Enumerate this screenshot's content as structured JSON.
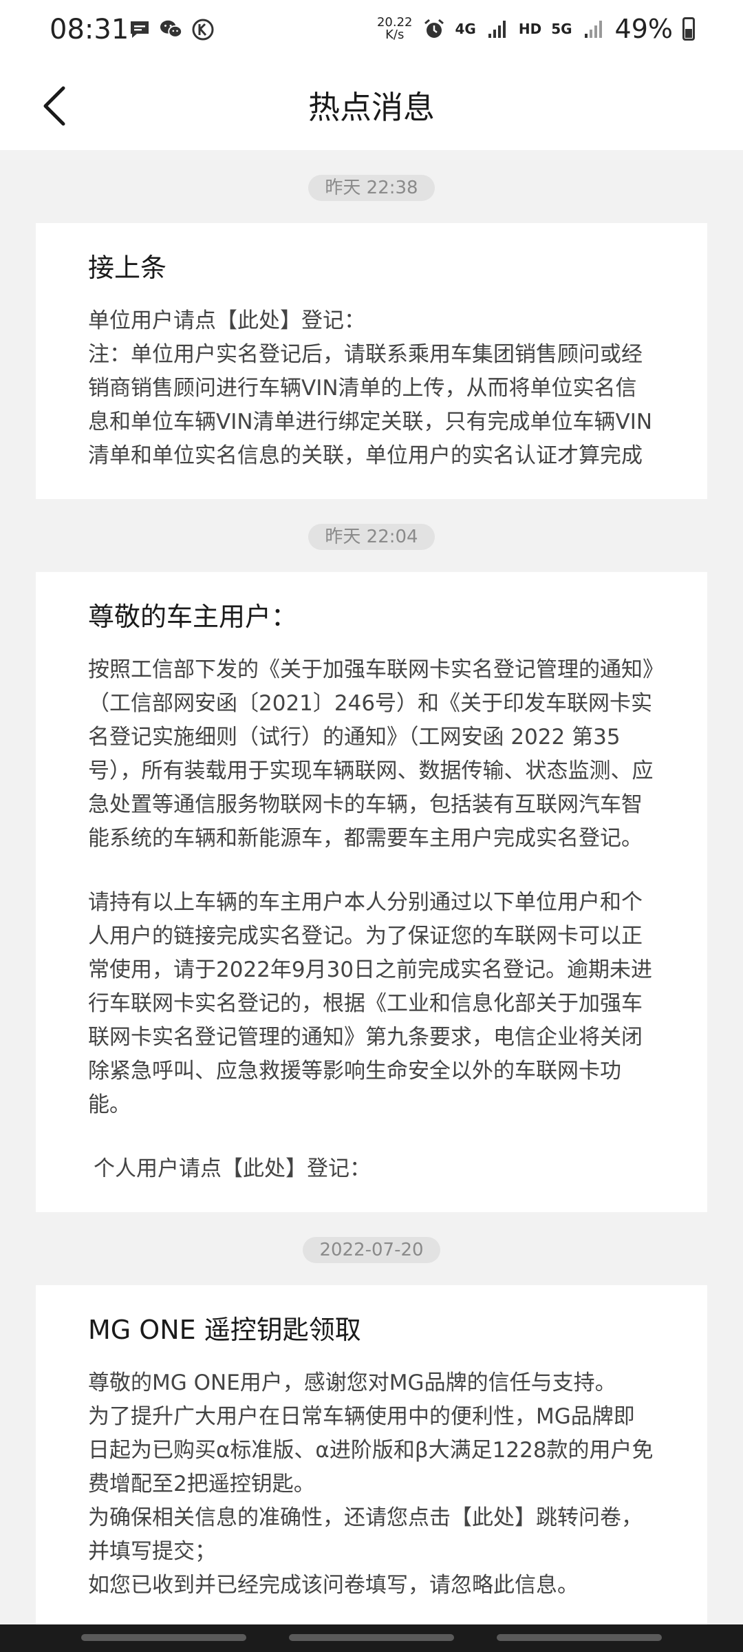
{
  "status_bar": {
    "time": "08:31",
    "net_speed_value": "20.22",
    "net_speed_unit": "K/s",
    "sig_4g": "4G",
    "sig_hd": "HD",
    "sig_5g": "5G",
    "battery": "49%"
  },
  "header": {
    "title": "热点消息"
  },
  "messages": [
    {
      "time": "昨天  22:38",
      "title": "接上条",
      "paragraphs": [
        "单位用户请点【此处】登记：",
        "注：单位用户实名登记后，请联系乘用车集团销售顾问或经销商销售顾问进行车辆VIN清单的上传，从而将单位实名信息和单位车辆VIN清单进行绑定关联，只有完成单位车辆VIN清单和单位实名信息的关联，单位用户的实名认证才算完成"
      ]
    },
    {
      "time": "昨天  22:04",
      "title": "尊敬的车主用户：",
      "paragraphs": [
        "按照工信部下发的《关于加强车联网卡实名登记管理的通知》（工信部网安函〔2021〕246号）和《关于印发车联网卡实名登记实施细则（试行）的通知》（工网安函 2022 第35号），所有装载用于实现车辆联网、数据传输、状态监测、应急处置等通信服务物联网卡的车辆，包括装有互联网汽车智能系统的车辆和新能源车，都需要车主用户完成实名登记。",
        "请持有以上车辆的车主用户本人分别通过以下单位用户和个人用户的链接完成实名登记。为了保证您的车联网卡可以正常使用，请于2022年9月30日之前完成实名登记。逾期未进行车联网卡实名登记的，根据《工业和信息化部关于加强车联网卡实名登记管理的通知》第九条要求，电信企业将关闭除紧急呼叫、应急救援等影响生命安全以外的车联网卡功能。",
        "个人用户请点【此处】登记："
      ]
    },
    {
      "time": "2022-07-20",
      "title": "MG ONE 遥控钥匙领取",
      "paragraphs": [
        "尊敬的MG ONE用户，感谢您对MG品牌的信任与支持。",
        "为了提升广大用户在日常车辆使用中的便利性，MG品牌即日起为已购买α标准版、α进阶版和β大满足1228款的用户免费增配至2把遥控钥匙。",
        "为确保相关信息的准确性，还请您点击【此处】跳转问卷，并填写提交；",
        "如您已收到并已经完成该问卷填写，请忽略此信息。"
      ]
    }
  ]
}
